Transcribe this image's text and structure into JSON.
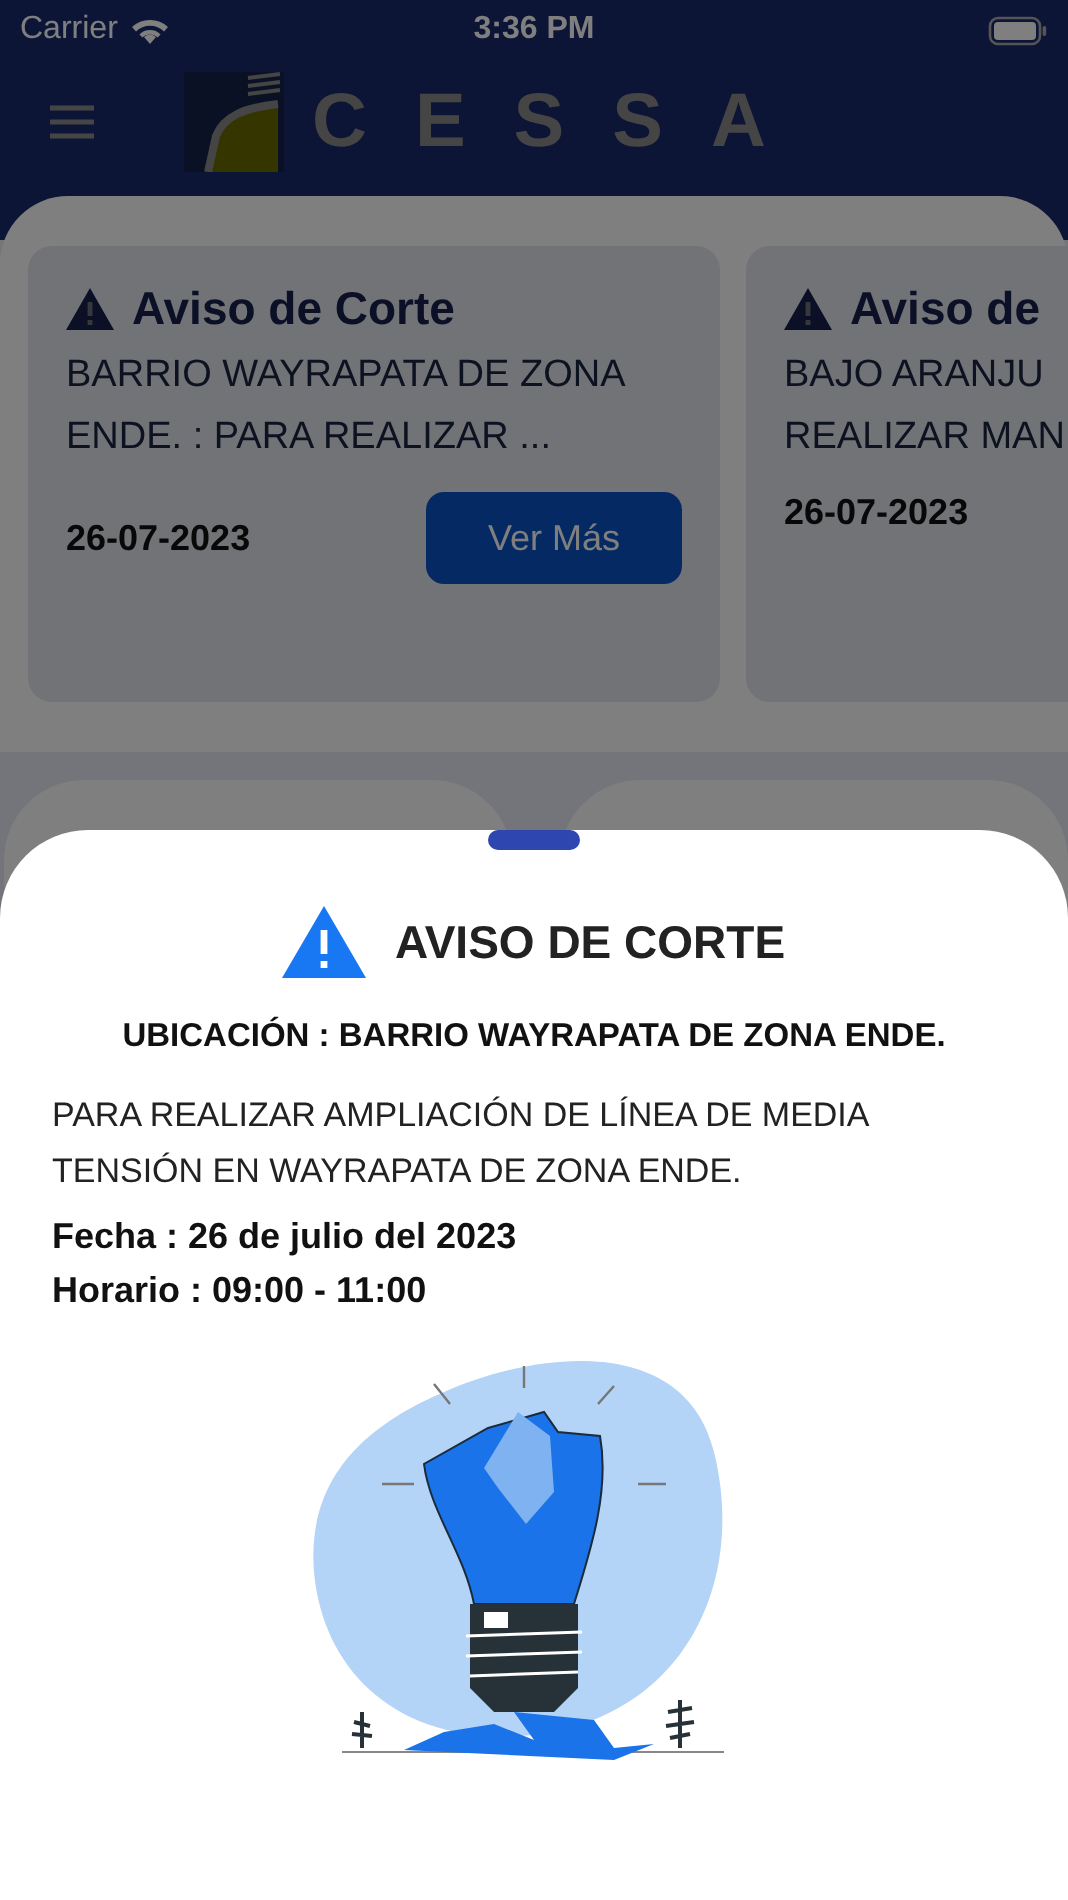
{
  "status_bar": {
    "carrier": "Carrier",
    "time": "3:36 PM"
  },
  "header": {
    "logo_text": "CESSA"
  },
  "notices": [
    {
      "title": "Aviso de Corte",
      "summary_lines": [
        "BARRIO WAYRAPATA DE ZONA",
        "ENDE. : PARA REALIZAR ..."
      ],
      "date": "26-07-2023",
      "button": "Ver Más"
    },
    {
      "title": "Aviso de",
      "summary_lines": [
        "BAJO ARANJU",
        "REALIZAR MAN"
      ],
      "date": "26-07-2023"
    }
  ],
  "detail_sheet": {
    "title": "AVISO DE CORTE",
    "location": "UBICACIÓN : BARRIO WAYRAPATA DE ZONA ENDE.",
    "description": "PARA REALIZAR AMPLIACIÓN DE LÍNEA DE MEDIA TENSIÓN EN WAYRAPATA DE ZONA ENDE.",
    "date": "Fecha : 26 de julio del 2023",
    "schedule": "Horario : 09:00 - 11:00"
  }
}
